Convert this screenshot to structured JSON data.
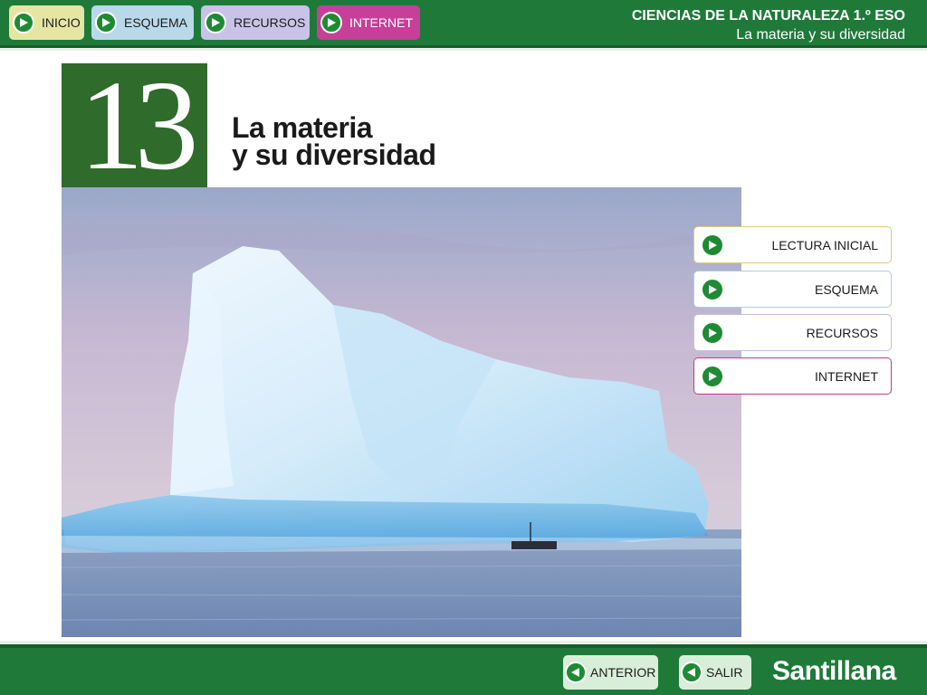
{
  "header": {
    "nav": [
      {
        "label": "INICIO",
        "icon": "play-icon",
        "color": "#e5e6a3"
      },
      {
        "label": "ESQUEMA",
        "icon": "play-icon",
        "color": "#b9d9ea"
      },
      {
        "label": "RECURSOS",
        "icon": "play-icon",
        "color": "#c9c3e7"
      },
      {
        "label": "INTERNET",
        "icon": "play-icon",
        "color": "#c63f98"
      }
    ],
    "course": "CIENCIAS DE LA NATURALEZA 1.º ESO",
    "unit_name": "La materia y su diversidad"
  },
  "unit": {
    "number": "13",
    "title_line1": "La materia",
    "title_line2": "y su diversidad"
  },
  "menu": [
    {
      "label": "LECTURA INICIAL",
      "icon": "play-icon",
      "border": "#e3c97a"
    },
    {
      "label": "ESQUEMA",
      "icon": "play-icon",
      "border": "#a9d0e6"
    },
    {
      "label": "RECURSOS",
      "icon": "play-icon",
      "border": "#c3bde6"
    },
    {
      "label": "INTERNET",
      "icon": "play-icon",
      "border": "#b93d8c"
    }
  ],
  "footer": {
    "previous_label": "ANTERIOR",
    "exit_label": "SALIR",
    "brand": "Santillana"
  },
  "colors": {
    "bar_green": "#1f7a3a",
    "unit_green": "#2f6b2a",
    "icon_green": "#1f8a34"
  }
}
